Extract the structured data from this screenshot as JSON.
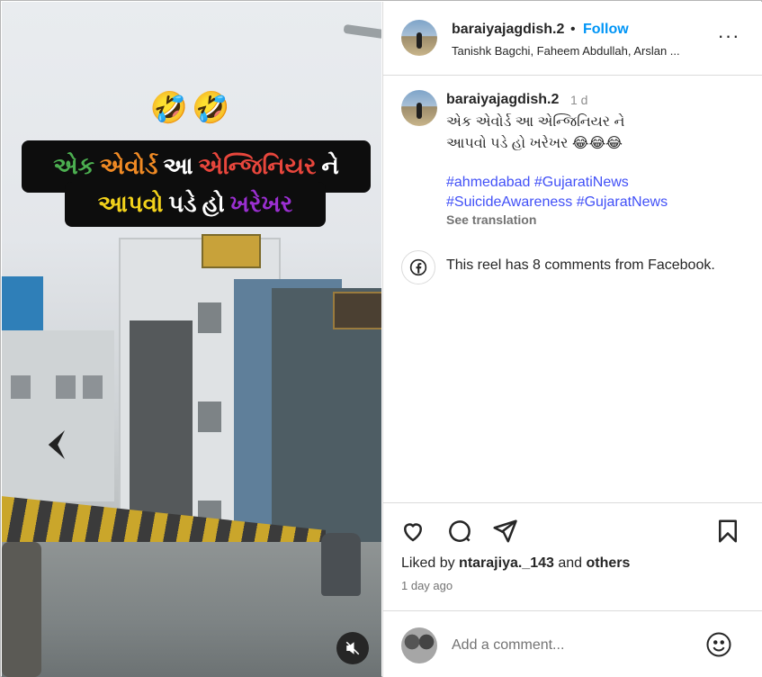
{
  "reel": {
    "emojis": "🤣🤣",
    "caption_line1": [
      {
        "text": "એક",
        "color": "#4caf50"
      },
      {
        "text": "એવોર્ડ",
        "color": "#f08a24"
      },
      {
        "text": "આ",
        "color": "#ffffff"
      },
      {
        "text": "એન્જિનિયર",
        "color": "#e8463c"
      },
      {
        "text": "ને",
        "color": "#ffffff"
      }
    ],
    "caption_line2": [
      {
        "text": "આપવો",
        "color": "#f2d21b"
      },
      {
        "text": "પડે",
        "color": "#ffffff"
      },
      {
        "text": "હો",
        "color": "#ffffff"
      },
      {
        "text": "ખરેખર",
        "color": "#9b2fd1"
      }
    ],
    "mute_icon": "speaker-muted-icon"
  },
  "header": {
    "username": "baraiyajagdish.2",
    "dot": "•",
    "follow_label": "Follow",
    "collaborators": "Tanishk Bagchi, Faheem Abdullah, Arslan ...",
    "more_icon": "···"
  },
  "caption": {
    "username": "baraiyajagdish.2",
    "time": "1 d",
    "text_line1": "એક એવોર્ડ આ એન્જિનિયર ને",
    "text_line2": "આપવો પડે હો ખરેખર 😂😂😂",
    "hashtags_line1": [
      "#ahmedabad",
      "#GujaratiNews"
    ],
    "hashtags_line2": [
      "#SuicideAwareness",
      "#GujaratNews"
    ],
    "see_translation": "See translation",
    "facebook_note": "This reel has 8 comments from Facebook."
  },
  "actions": {
    "liked_by_prefix": "Liked by",
    "liked_by_user": "ntarajiya._143",
    "liked_by_and": "and",
    "liked_by_others": "others",
    "time_ago": "1 day ago"
  },
  "comment": {
    "placeholder": "Add a comment..."
  },
  "colors": {
    "follow": "#0095f6",
    "hashtag": "#4150f7",
    "caption_bg": "#0d0d0d"
  }
}
